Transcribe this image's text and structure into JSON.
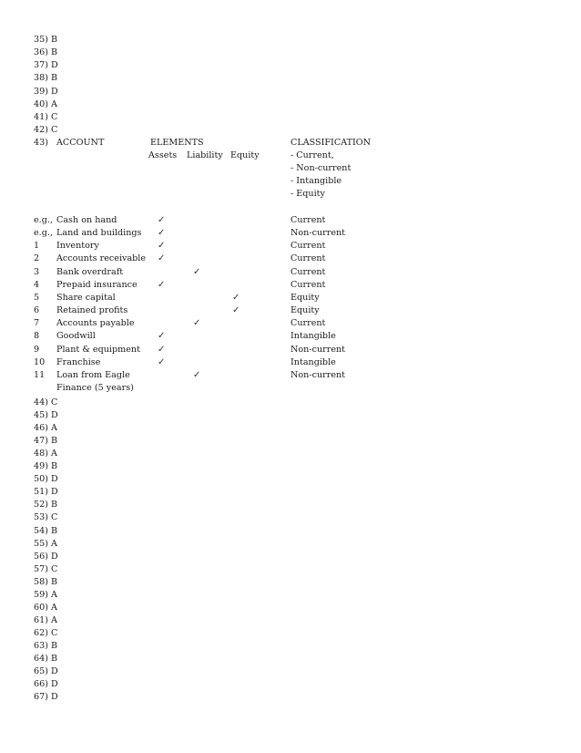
{
  "answers_before": [
    {
      "num": "35)",
      "ans": "B"
    },
    {
      "num": "36)",
      "ans": "B"
    },
    {
      "num": "37)",
      "ans": "D"
    },
    {
      "num": "38)",
      "ans": "B"
    },
    {
      "num": "39)",
      "ans": "D"
    },
    {
      "num": "40)",
      "ans": "A"
    },
    {
      "num": "41)",
      "ans": "C"
    },
    {
      "num": "42)",
      "ans": "C"
    }
  ],
  "q43": {
    "num": "43)",
    "header": {
      "account": "ACCOUNT",
      "elements": "ELEMENTS",
      "classification": "CLASSIFICATION",
      "assets": "Assets",
      "liability": "Liability",
      "equity": "Equity",
      "classification_options": [
        "- Current,",
        "- Non-current",
        "- Intangible",
        "- Equity"
      ]
    },
    "check_glyph": "✓",
    "rows": [
      {
        "no": "e.g.,",
        "account": "Cash on hand",
        "element": "assets",
        "classification": "Current"
      },
      {
        "no": "e.g.,",
        "account": "Land and buildings",
        "element": "assets",
        "classification": "Non-current"
      },
      {
        "no": "1",
        "account": "Inventory",
        "element": "assets",
        "classification": "Current"
      },
      {
        "no": "2",
        "account": "Accounts receivable",
        "element": "assets",
        "classification": "Current"
      },
      {
        "no": "3",
        "account": "Bank overdraft",
        "element": "liability",
        "classification": "Current"
      },
      {
        "no": "4",
        "account": "Prepaid insurance",
        "element": "assets",
        "classification": "Current"
      },
      {
        "no": "5",
        "account": "Share capital",
        "element": "equity",
        "classification": "Equity"
      },
      {
        "no": "6",
        "account": "Retained profits",
        "element": "equity",
        "classification": "Equity"
      },
      {
        "no": "7",
        "account": "Accounts payable",
        "element": "liability",
        "classification": "Current"
      },
      {
        "no": "8",
        "account": "Goodwill",
        "element": "assets",
        "classification": "Intangible"
      },
      {
        "no": "9",
        "account": "Plant & equipment",
        "element": "assets",
        "classification": "Non-current"
      },
      {
        "no": "10",
        "account": "Franchise",
        "element": "assets",
        "classification": "Intangible"
      },
      {
        "no": "11",
        "account": "Loan from Eagle",
        "account_cont": "Finance (5 years)",
        "element": "liability",
        "classification": "Non-current"
      }
    ]
  },
  "answers_after": [
    {
      "num": "44)",
      "ans": "C"
    },
    {
      "num": "45)",
      "ans": "D"
    },
    {
      "num": "46)",
      "ans": "A"
    },
    {
      "num": "47)",
      "ans": "B"
    },
    {
      "num": "48)",
      "ans": "A"
    },
    {
      "num": "49)",
      "ans": "B"
    },
    {
      "num": "50)",
      "ans": "D"
    },
    {
      "num": "51)",
      "ans": "D"
    },
    {
      "num": "52)",
      "ans": "B"
    },
    {
      "num": "53)",
      "ans": "C"
    },
    {
      "num": "54)",
      "ans": "B"
    },
    {
      "num": "55)",
      "ans": "A"
    },
    {
      "num": "56)",
      "ans": "D"
    },
    {
      "num": "57)",
      "ans": "C"
    },
    {
      "num": "58)",
      "ans": "B"
    },
    {
      "num": "59)",
      "ans": "A"
    },
    {
      "num": "60)",
      "ans": "A"
    },
    {
      "num": "61)",
      "ans": "A"
    },
    {
      "num": "62)",
      "ans": "C"
    },
    {
      "num": "63)",
      "ans": "B"
    },
    {
      "num": "64)",
      "ans": "B"
    },
    {
      "num": "65)",
      "ans": "D"
    },
    {
      "num": "66)",
      "ans": "D"
    },
    {
      "num": "67)",
      "ans": "D"
    }
  ]
}
